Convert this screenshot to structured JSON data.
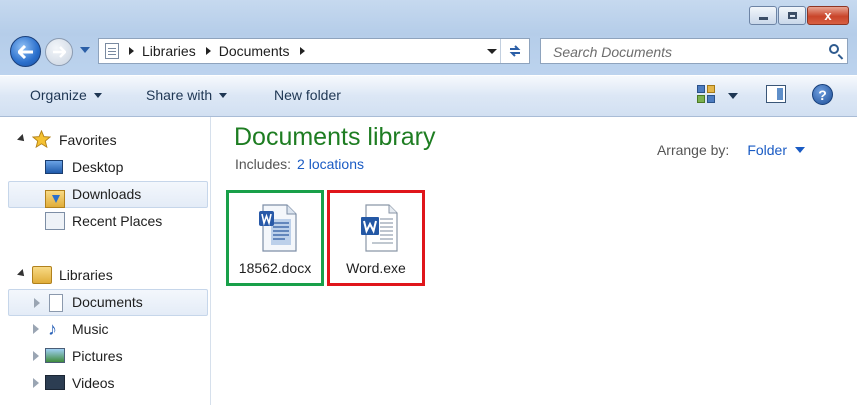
{
  "window": {
    "controls": {
      "minimize": "",
      "maximize": "",
      "close": "x"
    }
  },
  "address": {
    "crumbs": [
      "Libraries",
      "Documents"
    ]
  },
  "search": {
    "placeholder": "Search Documents"
  },
  "toolbar": {
    "organize": "Organize",
    "share_with": "Share with",
    "new_folder": "New folder",
    "help": "?"
  },
  "nav": {
    "favorites": {
      "label": "Favorites",
      "items": [
        "Desktop",
        "Downloads",
        "Recent Places"
      ]
    },
    "libraries": {
      "label": "Libraries",
      "items": [
        "Documents",
        "Music",
        "Pictures",
        "Videos"
      ]
    }
  },
  "library": {
    "title": "Documents library",
    "includes_label": "Includes:",
    "locations_link": "2 locations",
    "arrange_label": "Arrange by:",
    "arrange_value": "Folder"
  },
  "files": [
    {
      "name": "18562.docx",
      "highlight": "#18a049"
    },
    {
      "name": "Word.exe",
      "highlight": "#e0161b"
    }
  ],
  "colors": {
    "library_title": "#1e7d22",
    "link": "#1a5bc4"
  }
}
